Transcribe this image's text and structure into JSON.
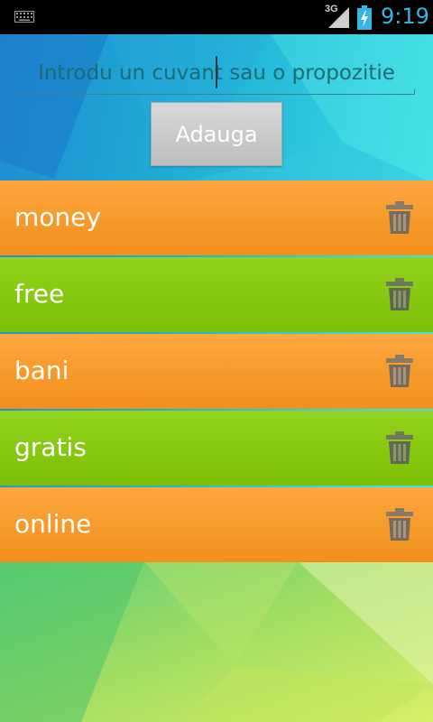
{
  "status_bar": {
    "network_label": "3G",
    "time": "9:19",
    "icons": [
      "keyboard-icon",
      "signal-icon",
      "battery-charging-icon"
    ]
  },
  "input": {
    "placeholder": "Introdu un cuvant sau o propozitie",
    "value": ""
  },
  "add_button": {
    "label": "Adauga"
  },
  "words": [
    {
      "text": "money",
      "color": "#f59a2a"
    },
    {
      "text": "free",
      "color": "#86c80f"
    },
    {
      "text": "bani",
      "color": "#f59a2a"
    },
    {
      "text": "gratis",
      "color": "#86c80f"
    },
    {
      "text": "online",
      "color": "#f59a2a"
    }
  ],
  "item_action_icon": "trash-icon",
  "colors": {
    "accent": "#33b5e5",
    "orange": "#f59a2a",
    "green": "#86c80f"
  }
}
